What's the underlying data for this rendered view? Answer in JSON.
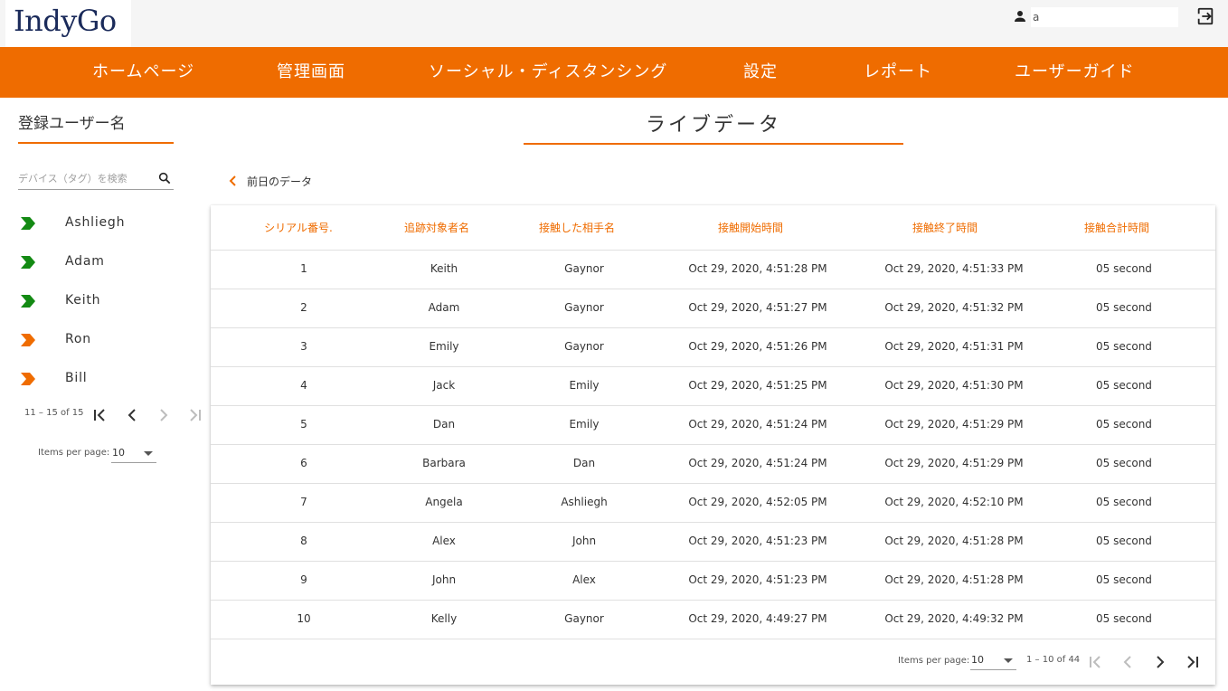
{
  "header": {
    "logo": "IndyGo",
    "user_name": "a",
    "icons": {
      "user": "person-icon",
      "logout": "logout-icon"
    }
  },
  "nav": {
    "items": [
      "ホームページ",
      "管理画面",
      "ソーシャル・ディスタンシング",
      "設定",
      "レポート",
      "ユーザーガイド"
    ]
  },
  "sidebar": {
    "title": "登録ユーザー名",
    "search_placeholder": "デバイス（タグ）を検索",
    "devices": [
      {
        "name": "Ashliegh",
        "status_color": "#138a13"
      },
      {
        "name": "Adam",
        "status_color": "#138a13"
      },
      {
        "name": "Keith",
        "status_color": "#138a13"
      },
      {
        "name": "Ron",
        "status_color": "#ef6c00"
      },
      {
        "name": "Bill",
        "status_color": "#ef6c00"
      }
    ],
    "range_label": "11 – 15 of 15",
    "items_per_page_label": "Items per page:",
    "items_per_page_value": "10"
  },
  "main": {
    "title": "ライブデータ",
    "prev_link": "前日のデータ",
    "columns": [
      "シリアル番号.",
      "追跡対象者名",
      "接触した相手名",
      "接触開始時間",
      "接触終了時間",
      "接触合計時間"
    ],
    "rows": [
      [
        "1",
        "Keith",
        "Gaynor",
        "Oct 29, 2020, 4:51:28 PM",
        "Oct 29, 2020, 4:51:33 PM",
        "05 second"
      ],
      [
        "2",
        "Adam",
        "Gaynor",
        "Oct 29, 2020, 4:51:27 PM",
        "Oct 29, 2020, 4:51:32 PM",
        "05 second"
      ],
      [
        "3",
        "Emily",
        "Gaynor",
        "Oct 29, 2020, 4:51:26 PM",
        "Oct 29, 2020, 4:51:31 PM",
        "05 second"
      ],
      [
        "4",
        "Jack",
        "Emily",
        "Oct 29, 2020, 4:51:25 PM",
        "Oct 29, 2020, 4:51:30 PM",
        "05 second"
      ],
      [
        "5",
        "Dan",
        "Emily",
        "Oct 29, 2020, 4:51:24 PM",
        "Oct 29, 2020, 4:51:29 PM",
        "05 second"
      ],
      [
        "6",
        "Barbara",
        "Dan",
        "Oct 29, 2020, 4:51:24 PM",
        "Oct 29, 2020, 4:51:29 PM",
        "05 second"
      ],
      [
        "7",
        "Angela",
        "Ashliegh",
        "Oct 29, 2020, 4:52:05 PM",
        "Oct 29, 2020, 4:52:10 PM",
        "05 second"
      ],
      [
        "8",
        "Alex",
        "John",
        "Oct 29, 2020, 4:51:23 PM",
        "Oct 29, 2020, 4:51:28 PM",
        "05 second"
      ],
      [
        "9",
        "John",
        "Alex",
        "Oct 29, 2020, 4:51:23 PM",
        "Oct 29, 2020, 4:51:28 PM",
        "05 second"
      ],
      [
        "10",
        "Kelly",
        "Gaynor",
        "Oct 29, 2020, 4:49:27 PM",
        "Oct 29, 2020, 4:49:32 PM",
        "05 second"
      ]
    ],
    "items_per_page_label": "Items per page:",
    "items_per_page_value": "10",
    "range_label": "1 – 10 of 44"
  },
  "colors": {
    "accent": "#ef6c00",
    "online": "#138a13"
  }
}
